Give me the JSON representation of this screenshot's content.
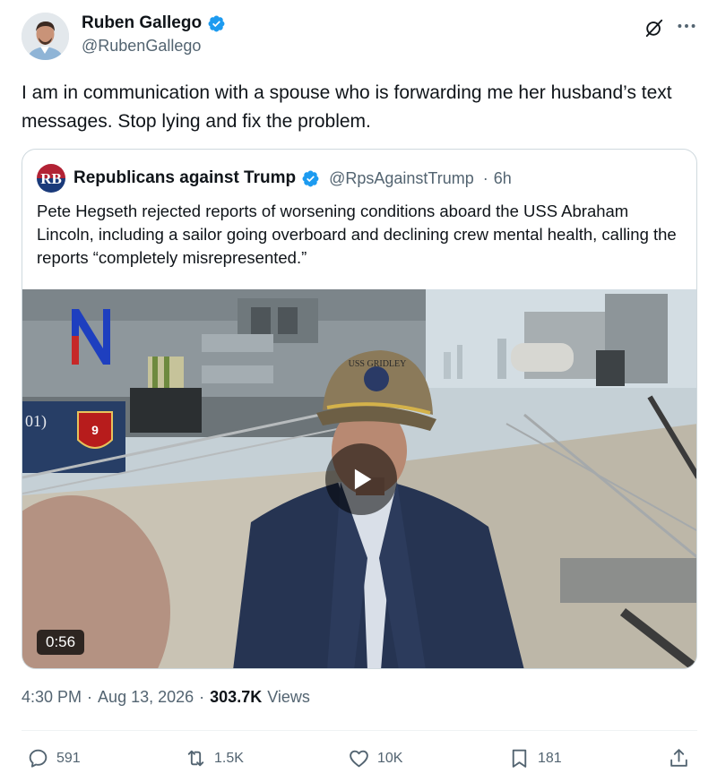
{
  "author": {
    "name": "Ruben Gallego",
    "handle": "@RubenGallego"
  },
  "tweet": {
    "text": "I am in communication with a spouse who is forwarding me her husband’s text messages.  Stop lying and fix the problem."
  },
  "quote": {
    "avatar_text": "RB",
    "name": "Republicans against Trump",
    "handle": "@RpsAgainstTrump",
    "separator": "·",
    "time": "6h",
    "text": "Pete Hegseth rejected reports of worsening conditions aboard the USS Abraham Lincoln, including a sailor going overboard and declining crew mental health, calling the reports “completely misrepresented.”",
    "video": {
      "duration": "0:56",
      "hull_text": "01)",
      "crest_number": "9",
      "cap_text": "USS GRIDLEY"
    }
  },
  "meta": {
    "time": "4:30 PM",
    "sep1": "·",
    "date": "Aug 13, 2026",
    "sep2": "·",
    "views_count": "303.7K",
    "views_label": "Views"
  },
  "actions": {
    "replies": "591",
    "reposts": "1.5K",
    "likes": "10K",
    "bookmarks": "181"
  },
  "colors": {
    "verified_blue": "#1d9bf0",
    "text_primary": "#0f1419",
    "text_secondary": "#536471",
    "border": "#cfd9de"
  },
  "icons": [
    "verified-badge-icon",
    "grok-icon",
    "more-icon",
    "play-icon",
    "reply-icon",
    "repost-icon",
    "like-icon",
    "bookmark-icon",
    "share-icon"
  ]
}
